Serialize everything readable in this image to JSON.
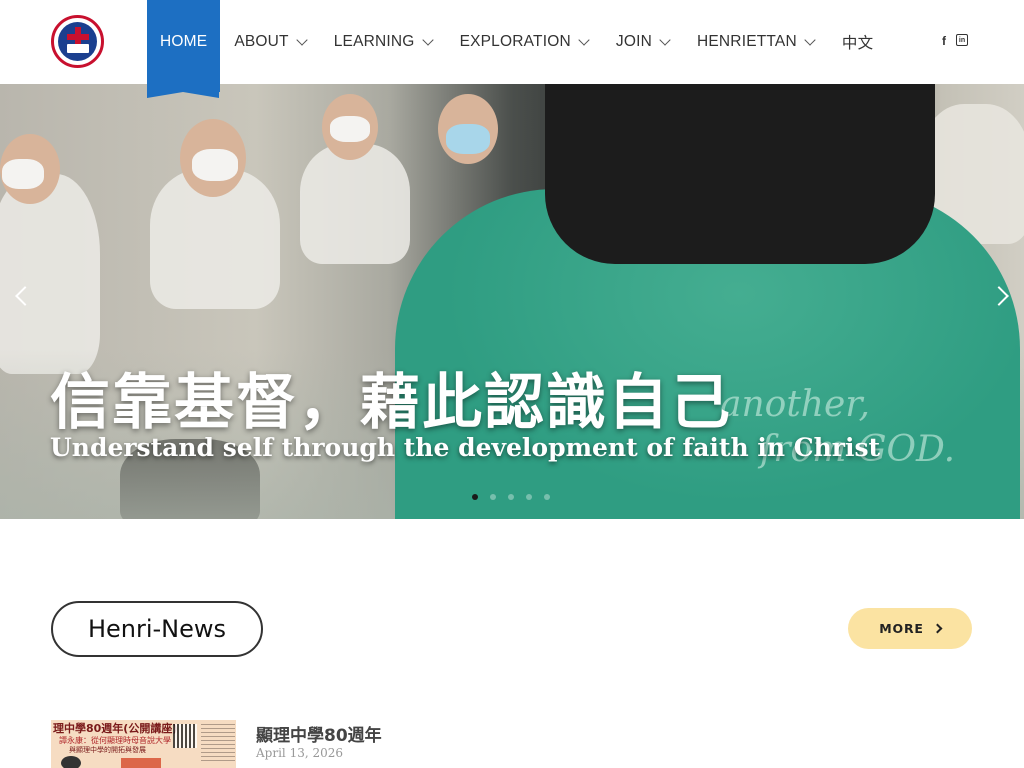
{
  "brand": {
    "logo_icon": "school-crest-icon",
    "accent_color": "#1d6fc2",
    "crest_color": "#c8102e"
  },
  "nav": {
    "items": [
      {
        "label": "HOME",
        "active": true,
        "dropdown": false
      },
      {
        "label": "ABOUT",
        "active": false,
        "dropdown": true
      },
      {
        "label": "LEARNING",
        "active": false,
        "dropdown": true
      },
      {
        "label": "EXPLORATION",
        "active": false,
        "dropdown": true
      },
      {
        "label": "JOIN",
        "active": false,
        "dropdown": true
      },
      {
        "label": "HENRIETTAN",
        "active": false,
        "dropdown": true
      },
      {
        "label": "中文",
        "active": false,
        "dropdown": false
      }
    ]
  },
  "social": {
    "facebook": "f",
    "linkedin": "in"
  },
  "hero": {
    "title": "信靠基督，藉此認識自己",
    "subtitle": "Understand self through the development of faith in Christ",
    "shirt_text_1": "another,",
    "shirt_text_2": "from GOD.",
    "slide_count": 5,
    "active_slide": 1
  },
  "news": {
    "heading": "Henri-News",
    "more_label": "MORE",
    "items": [
      {
        "title": "顯理中學80週年",
        "date": "April 13, 2026",
        "thumb_heading": "理中學80週年(公開講座)",
        "thumb_sub": "譚永康：從何顯理時母音說大學",
        "thumb_sub2": "與顯理中學的開拓與發展"
      }
    ]
  }
}
